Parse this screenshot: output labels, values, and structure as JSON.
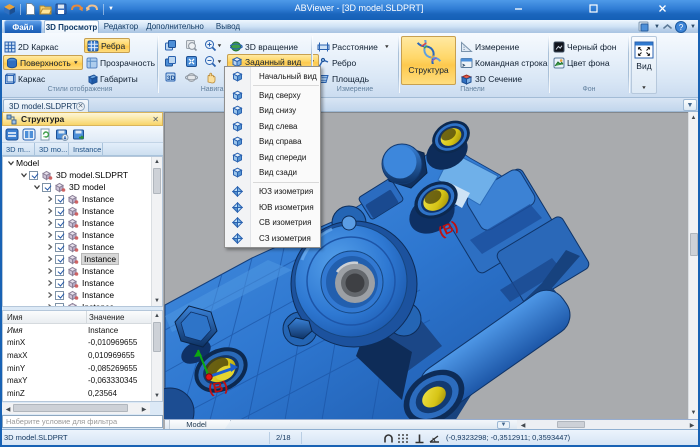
{
  "window": {
    "title": "ABViewer  - [3D model.SLDPRT]"
  },
  "tabs": {
    "file": "Файл",
    "view3d": "3D Просмотр",
    "editor": "Редактор",
    "extra": "Дополнительно",
    "output": "Вывод"
  },
  "ribbon": {
    "groups": {
      "styles": {
        "label": "Стили отображения",
        "b2dwire": "2D Каркас",
        "bedges": "Ребра",
        "bsurface": "Поверхность",
        "btransp": "Прозрачность",
        "bwire": "Каркас",
        "bdims": "Габариты"
      },
      "nav": {
        "label": "Навигация",
        "brotate": "3D вращение",
        "bview": "Заданный вид"
      },
      "measure": {
        "label": "Измерение",
        "bdist": "Расстояние",
        "bedge": "Ребро",
        "barea": "Площадь"
      },
      "panels": {
        "label": "Панели",
        "bstructure": "Структура",
        "bmeasure": "Измерение",
        "bcmd": "Командная строка",
        "bsection": "3D Сечение"
      },
      "bg": {
        "label": "Фон",
        "bblack": "Черный фон",
        "bcolor": "Цвет фона"
      },
      "view": {
        "label": "Вид"
      }
    }
  },
  "menu": {
    "items": [
      {
        "label": "Начальный вид"
      },
      {
        "label": "Вид сверху"
      },
      {
        "label": "Вид снизу"
      },
      {
        "label": "Вид слева"
      },
      {
        "label": "Вид справа"
      },
      {
        "label": "Вид спереди"
      },
      {
        "label": "Вид сзади"
      },
      {
        "label": "ЮЗ изометрия"
      },
      {
        "label": "ЮВ изометрия"
      },
      {
        "label": "СВ изометрия"
      },
      {
        "label": "СЗ изометрия"
      }
    ]
  },
  "docbar": {
    "tab": "3D model.SLDPRT"
  },
  "panel": {
    "title": "Структура",
    "tabs": {
      "t0": "3D m...",
      "t1": "3D mo...",
      "t2": "Instance"
    },
    "tree": {
      "root": "Model",
      "node1": "3D model.SLDPRT",
      "node2": "3D model",
      "instance": "Instance"
    },
    "props": {
      "h0": "Имя",
      "h1": "Значение",
      "rows": [
        {
          "name": "Имя",
          "value": "Instance"
        },
        {
          "name": "minX",
          "value": "-0,010969655"
        },
        {
          "name": "maxX",
          "value": "0,010969655"
        },
        {
          "name": "minY",
          "value": "-0,085269655"
        },
        {
          "name": "maxY",
          "value": "-0,063330345"
        },
        {
          "name": "minZ",
          "value": "0,23564"
        }
      ]
    },
    "filter_placeholder": "Наберите условие для фильтра"
  },
  "viewport": {
    "sheet_tab": "Model",
    "label_b1": "(B)",
    "label_b2": "(B)"
  },
  "statusbar": {
    "file": "3D model.SLDPRT",
    "page": "2/18",
    "coords": "(-0,9323298; -0,3512911; 0,3593447)"
  }
}
